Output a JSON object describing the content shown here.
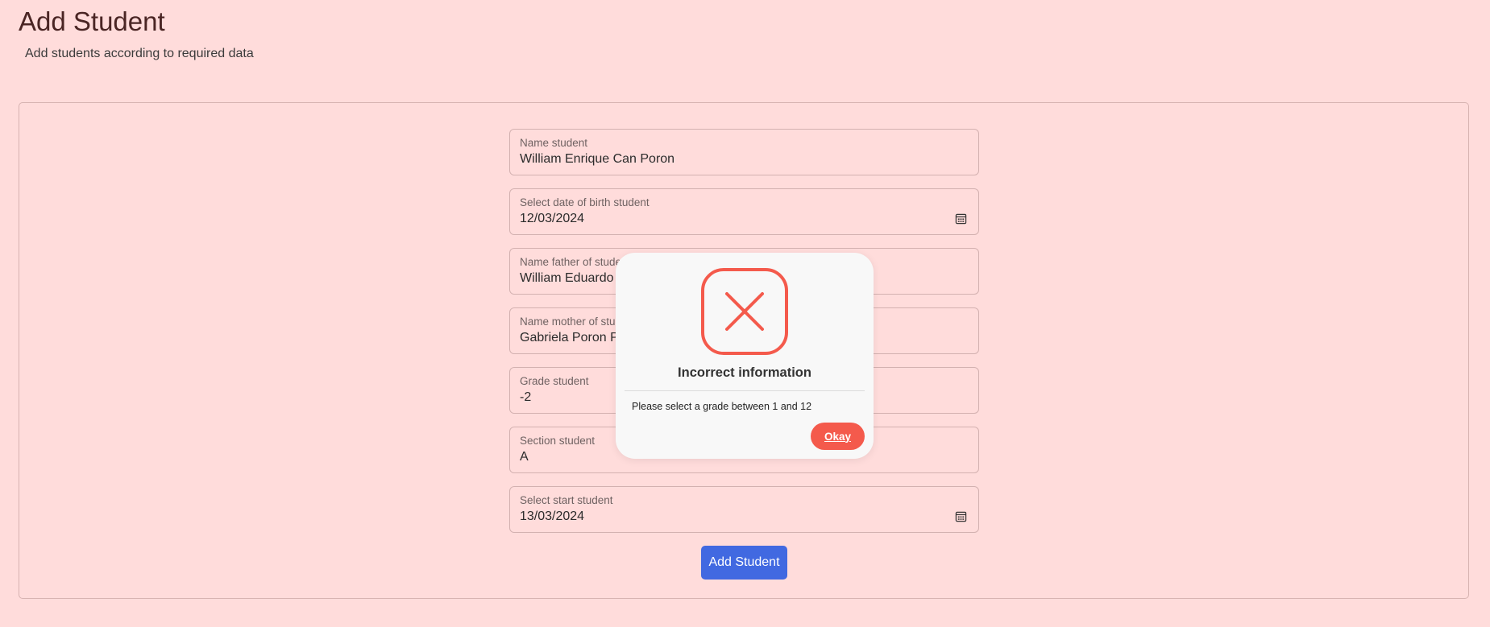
{
  "header": {
    "title": "Add Student",
    "subtitle": "Add students according to required data"
  },
  "form": {
    "fields": [
      {
        "label": "Name student",
        "value": "William Enrique Can Poron",
        "icon": null
      },
      {
        "label": "Select date of birth student",
        "value": "12/03/2024",
        "icon": "calendar-icon"
      },
      {
        "label": "Name father of student",
        "value": "William Eduardo",
        "icon": null
      },
      {
        "label": "Name mother of student",
        "value": "Gabriela Poron Pe",
        "icon": null
      },
      {
        "label": "Grade student",
        "value": "-2",
        "icon": null
      },
      {
        "label": "Section student",
        "value": "A",
        "icon": null
      },
      {
        "label": "Select start student",
        "value": "13/03/2024",
        "icon": "calendar-icon"
      }
    ],
    "submit_label": "Add Student"
  },
  "dialog": {
    "icon": "error-x-icon",
    "title": "Incorrect information",
    "message": "Please select a grade between 1 and 12",
    "confirm_label": "Okay"
  },
  "colors": {
    "background": "#ffdcdb",
    "primary_button": "#4169e1",
    "error_accent": "#f45a4c"
  }
}
